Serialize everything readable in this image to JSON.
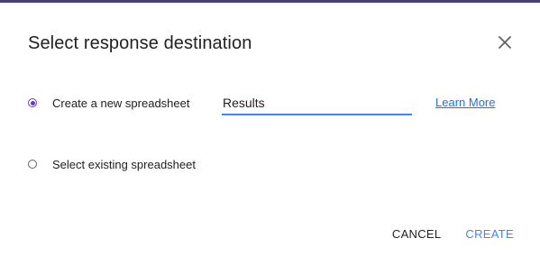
{
  "dialog": {
    "title": "Select response destination",
    "close_icon": "close-icon"
  },
  "options": {
    "new_spreadsheet": {
      "label": "Create a new spreadsheet",
      "selected": true,
      "name_value": "Results",
      "learn_more": "Learn More"
    },
    "existing_spreadsheet": {
      "label": "Select existing spreadsheet",
      "selected": false
    }
  },
  "actions": {
    "cancel_label": "CANCEL",
    "create_label": "CREATE"
  },
  "colors": {
    "accent_purple": "#673ab7",
    "header_bar": "#4a3f73",
    "link_blue": "#1a73e8",
    "action_blue": "#4285f4"
  }
}
